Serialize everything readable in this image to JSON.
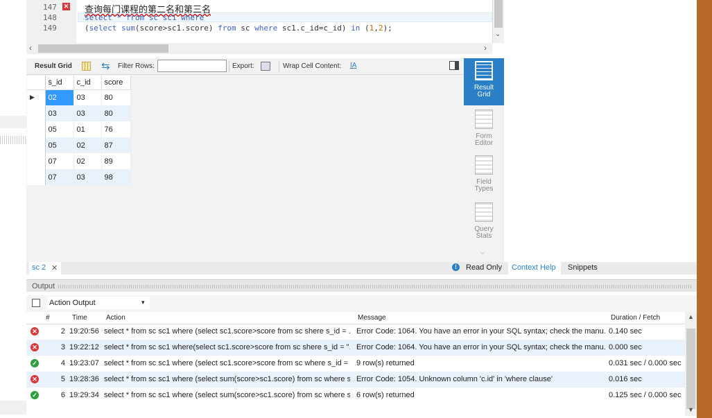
{
  "editor": {
    "lines": [
      {
        "num": "147",
        "text": "查询每门课程的第二名和第三名"
      },
      {
        "num": "148",
        "text": "select * from sc sc1 where"
      },
      {
        "num": "149",
        "text": "(select sum(score>sc1.score) from sc where sc1.c_id=c_id) in (1,2);"
      }
    ],
    "line_error_icon": "error-x-icon"
  },
  "toolbar": {
    "result_grid": "Result Grid",
    "filter_rows": "Filter Rows:",
    "filter_value": "",
    "export": "Export:",
    "wrap_cell": "Wrap Cell Content:"
  },
  "grid": {
    "columns": [
      "s_id",
      "c_id",
      "score"
    ],
    "rows": [
      [
        "02",
        "03",
        "80"
      ],
      [
        "03",
        "03",
        "80"
      ],
      [
        "05",
        "01",
        "76"
      ],
      [
        "05",
        "02",
        "87"
      ],
      [
        "07",
        "02",
        "89"
      ],
      [
        "07",
        "03",
        "98"
      ]
    ]
  },
  "side_panel": [
    {
      "label1": "Result",
      "label2": "Grid",
      "icon": "result-grid-icon",
      "active": true
    },
    {
      "label1": "Form",
      "label2": "Editor",
      "icon": "form-editor-icon",
      "active": false
    },
    {
      "label1": "Field",
      "label2": "Types",
      "icon": "field-types-icon",
      "active": false
    },
    {
      "label1": "Query",
      "label2": "Stats",
      "icon": "query-stats-icon",
      "active": false
    }
  ],
  "tabs": {
    "result_tab": "sc 2",
    "read_only": "Read Only",
    "context_help": "Context Help",
    "snippets": "Snippets"
  },
  "output": {
    "title": "Output",
    "selector": "Action Output",
    "columns": [
      "#",
      "Time",
      "Action",
      "Message",
      "Duration / Fetch"
    ],
    "rows": [
      {
        "status": "error",
        "num": "2",
        "time": "19:20:56",
        "action": "select * from sc sc1 where  (select sc1.score>score from sc shere s_id = ...",
        "message": "Error Code: 1064. You have an error in your SQL syntax; check the manu...",
        "duration": "0.140 sec"
      },
      {
        "status": "error",
        "num": "3",
        "time": "19:22:12",
        "action": "select * from sc sc1  where(select sc1.score>score from sc shere s_id = \"...",
        "message": "Error Code: 1064. You have an error in your SQL syntax; check the manu...",
        "duration": "0.000 sec"
      },
      {
        "status": "ok",
        "num": "4",
        "time": "19:23:07",
        "action": "select * from sc sc1 where  (select sc1.score>score from sc where s_id = ...",
        "message": "9 row(s) returned",
        "duration": "0.031 sec / 0.000 sec"
      },
      {
        "status": "error",
        "num": "5",
        "time": "19:28:36",
        "action": "select * from sc sc1 where (select sum(score>sc1.score) from sc where s...",
        "message": "Error Code: 1054. Unknown column 'c.id' in 'where clause'",
        "duration": "0.016 sec"
      },
      {
        "status": "ok",
        "num": "6",
        "time": "19:29:34",
        "action": "select * from sc sc1 where (select sum(score>sc1.score) from sc where s...",
        "message": "6 row(s) returned",
        "duration": "0.125 sec / 0.000 sec"
      }
    ]
  }
}
